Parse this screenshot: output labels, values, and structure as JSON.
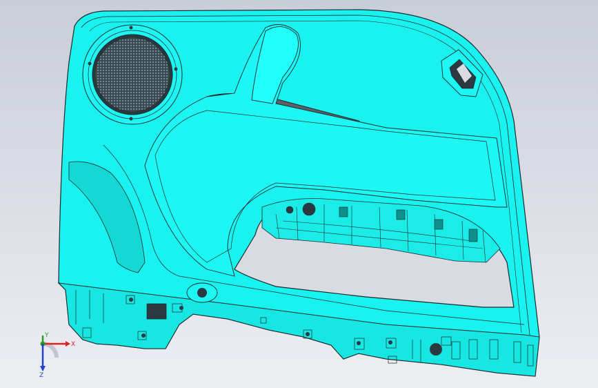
{
  "viewport": {
    "background_top": "#c9cdd8",
    "background_bottom": "#eceef2"
  },
  "model": {
    "fill_color": "#19f2ee",
    "edge_color": "#1a2a2a",
    "shadow_color": "#0fb8b4"
  },
  "triad": {
    "x_label": "X",
    "y_label": "Y",
    "z_label": "Z",
    "x_color": "#e02020",
    "y_color": "#20a020",
    "z_color": "#2040d0"
  }
}
